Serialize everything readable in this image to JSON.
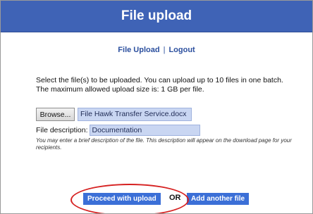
{
  "header": {
    "title": "File upload"
  },
  "nav": {
    "file_upload": "File Upload",
    "separator": "|",
    "logout": "Logout"
  },
  "instructions": {
    "line1": "Select the file(s) to be uploaded. You can upload up to 10 files in one batch.",
    "line2": "The maximum allowed upload size is: 1 GB per file."
  },
  "file": {
    "browse_label": "Browse...",
    "selected_file": "File Hawk Transfer Service.docx"
  },
  "description": {
    "label": "File description:",
    "value": "Documentation",
    "hint": "You may enter a brief description of the file. This description will appear on the download page for your recipients."
  },
  "actions": {
    "proceed_label": "Proceed with upload",
    "or_text": "OR",
    "add_label": "Add another file"
  },
  "colors": {
    "header_bg": "#3f63b6",
    "button_bg": "#3b6fd7",
    "field_bg": "#c9d6f2",
    "highlight": "#d62121"
  }
}
